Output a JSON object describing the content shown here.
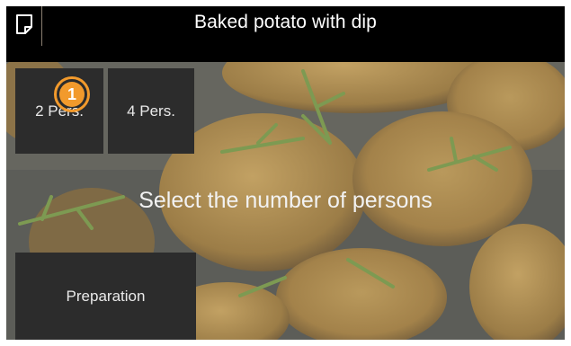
{
  "header": {
    "title": "Baked potato with dip",
    "note_icon": "note-icon"
  },
  "persons": {
    "options": [
      {
        "label": "2 Pers."
      },
      {
        "label": "4 Pers."
      }
    ]
  },
  "main": {
    "prompt": "Select the number of persons",
    "preparation_label": "Preparation"
  },
  "callout": {
    "number": "1"
  },
  "colors": {
    "topbar": "#000000",
    "tile": "#2c2c2c",
    "callout": "#f29a2c"
  }
}
